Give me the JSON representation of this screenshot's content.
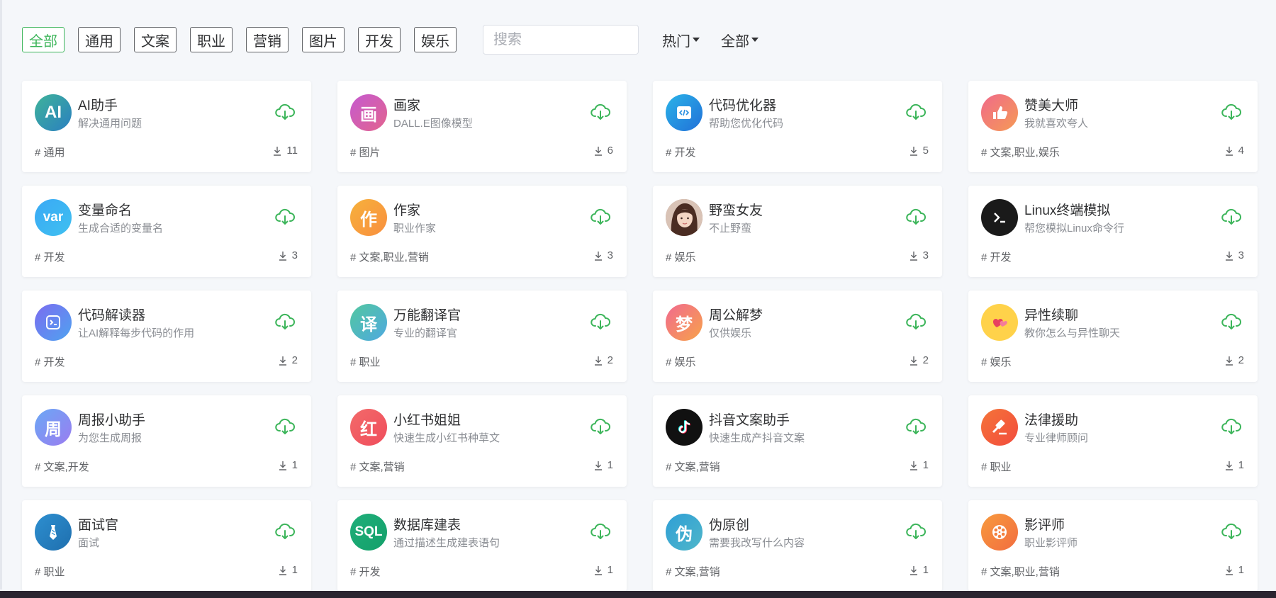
{
  "filters": {
    "categories": [
      {
        "label": "全部",
        "active": true
      },
      {
        "label": "通用",
        "active": false
      },
      {
        "label": "文案",
        "active": false
      },
      {
        "label": "职业",
        "active": false
      },
      {
        "label": "营销",
        "active": false
      },
      {
        "label": "图片",
        "active": false
      },
      {
        "label": "开发",
        "active": false
      },
      {
        "label": "娱乐",
        "active": false
      }
    ],
    "search_placeholder": "搜索",
    "sort_label": "热门",
    "scope_label": "全部"
  },
  "colors": {
    "accent": "#3cb55a",
    "card_bg": "#ffffff",
    "page_bg": "#f5f7fa"
  },
  "cards": [
    {
      "title": "AI助手",
      "desc": "解决通用问题",
      "tags": "# 通用",
      "count": "11",
      "avatar": {
        "type": "text",
        "text": "AI",
        "gradient": [
          "#3fb39a",
          "#2a7fc0"
        ],
        "name": "ai-assistant-avatar"
      }
    },
    {
      "title": "画家",
      "desc": "DALL.E图像模型",
      "tags": "# 图片",
      "count": "6",
      "avatar": {
        "type": "text",
        "text": "画",
        "gradient": [
          "#c55ad0",
          "#e2648e"
        ],
        "name": "painter-avatar"
      }
    },
    {
      "title": "代码优化器",
      "desc": "帮助您优化代码",
      "tags": "# 开发",
      "count": "5",
      "avatar": {
        "type": "code",
        "gradient": [
          "#2ab3e8",
          "#2170d8"
        ],
        "name": "code-optimizer-icon"
      }
    },
    {
      "title": "赞美大师",
      "desc": "我就喜欢夸人",
      "tags": "# 文案,职业,娱乐",
      "count": "4",
      "avatar": {
        "type": "thumb",
        "gradient": [
          "#f06a8a",
          "#f59a55"
        ],
        "name": "thumbs-up-icon"
      }
    },
    {
      "title": "变量命名",
      "desc": "生成合适的变量名",
      "tags": "# 开发",
      "count": "3",
      "avatar": {
        "type": "text",
        "text": "var",
        "gradient": [
          "#3aa9f5",
          "#3fc0f0"
        ],
        "name": "var-avatar"
      }
    },
    {
      "title": "作家",
      "desc": "职业作家",
      "tags": "# 文案,职业,营销",
      "count": "3",
      "avatar": {
        "type": "text",
        "text": "作",
        "gradient": [
          "#f6b13c",
          "#f98f3f"
        ],
        "name": "writer-avatar"
      }
    },
    {
      "title": "野蛮女友",
      "desc": "不止野蛮",
      "tags": "# 娱乐",
      "count": "3",
      "avatar": {
        "type": "photo",
        "gradient": [
          "#caa08a",
          "#6b4a3c"
        ],
        "name": "girlfriend-photo-avatar"
      }
    },
    {
      "title": "Linux终端模拟",
      "desc": "帮您模拟Linux命令行",
      "tags": "# 开发",
      "count": "3",
      "avatar": {
        "type": "terminal",
        "gradient": [
          "#1a1a1a",
          "#1a1a1a"
        ],
        "name": "terminal-icon"
      }
    },
    {
      "title": "代码解读器",
      "desc": "让AI解释每步代码的作用",
      "tags": "# 开发",
      "count": "2",
      "avatar": {
        "type": "console",
        "gradient": [
          "#7b6cf0",
          "#4fa3f0"
        ],
        "name": "console-icon"
      }
    },
    {
      "title": "万能翻译官",
      "desc": "专业的翻译官",
      "tags": "# 职业",
      "count": "2",
      "avatar": {
        "type": "text",
        "text": "译",
        "gradient": [
          "#52c7a0",
          "#4fa9e0"
        ],
        "name": "translator-avatar"
      }
    },
    {
      "title": "周公解梦",
      "desc": "仅供娱乐",
      "tags": "# 娱乐",
      "count": "2",
      "avatar": {
        "type": "text",
        "text": "梦",
        "gradient": [
          "#f16a8f",
          "#f7a24a"
        ],
        "name": "dream-avatar"
      }
    },
    {
      "title": "异性续聊",
      "desc": "教你怎么与异性聊天",
      "tags": "# 娱乐",
      "count": "2",
      "avatar": {
        "type": "hearts",
        "gradient": [
          "#ffd24a",
          "#ffd24a"
        ],
        "name": "hearts-icon"
      }
    },
    {
      "title": "周报小助手",
      "desc": "为您生成周报",
      "tags": "# 文案,开发",
      "count": "1",
      "avatar": {
        "type": "text",
        "text": "周",
        "gradient": [
          "#6aa8f5",
          "#9b7cf0"
        ],
        "name": "weekly-report-avatar"
      }
    },
    {
      "title": "小红书姐姐",
      "desc": "快速生成小红书种草文",
      "tags": "# 文案,营销",
      "count": "1",
      "avatar": {
        "type": "text",
        "text": "红",
        "gradient": [
          "#f26a6a",
          "#f04d5c"
        ],
        "name": "xiaohongshu-avatar"
      }
    },
    {
      "title": "抖音文案助手",
      "desc": "快速生成产抖音文案",
      "tags": "# 文案,营销",
      "count": "1",
      "avatar": {
        "type": "tiktok",
        "gradient": [
          "#111111",
          "#111111"
        ],
        "name": "tiktok-icon"
      }
    },
    {
      "title": "法律援助",
      "desc": "专业律师顾问",
      "tags": "# 职业",
      "count": "1",
      "avatar": {
        "type": "gavel",
        "gradient": [
          "#f5743a",
          "#f24c3c"
        ],
        "name": "gavel-icon"
      }
    },
    {
      "title": "面试官",
      "desc": "面试",
      "tags": "# 职业",
      "count": "1",
      "avatar": {
        "type": "tie",
        "gradient": [
          "#2d8fd0",
          "#1f6fae"
        ],
        "name": "tie-icon"
      }
    },
    {
      "title": "数据库建表",
      "desc": "通过描述生成建表语句",
      "tags": "# 开发",
      "count": "1",
      "avatar": {
        "type": "text",
        "text": "SQL",
        "gradient": [
          "#1fae7a",
          "#14a06a"
        ],
        "name": "sql-avatar"
      }
    },
    {
      "title": "伪原创",
      "desc": "需要我改写什么内容",
      "tags": "# 文案,营销",
      "count": "1",
      "avatar": {
        "type": "text",
        "text": "伪",
        "gradient": [
          "#2f9fd6",
          "#4fb6c9"
        ],
        "name": "rewrite-avatar"
      }
    },
    {
      "title": "影评师",
      "desc": "职业影评师",
      "tags": "# 文案,职业,营销",
      "count": "1",
      "avatar": {
        "type": "film",
        "gradient": [
          "#f79a3e",
          "#f26d3f"
        ],
        "name": "film-reel-icon"
      }
    }
  ]
}
